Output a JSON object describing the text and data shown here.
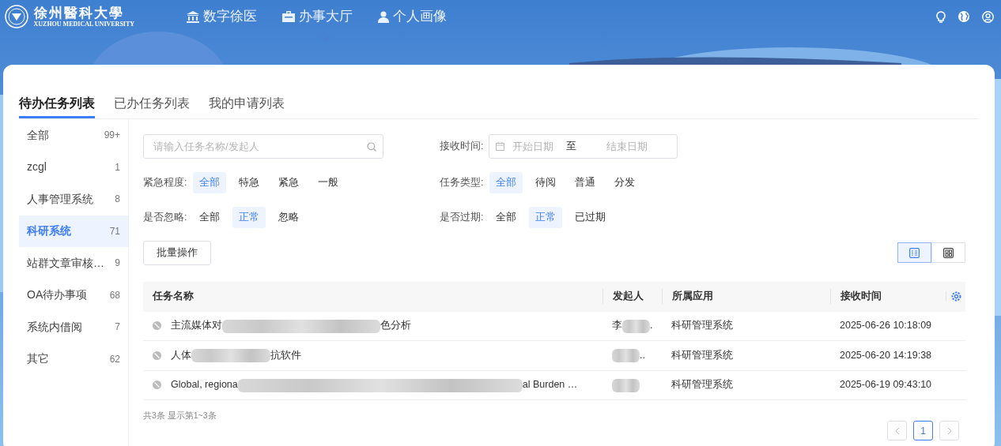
{
  "header": {
    "logo_title": "徐州醫科大學",
    "logo_subtitle": "XUZHOU MEDICAL UNIVERSITY",
    "nav": [
      {
        "label": "数字徐医"
      },
      {
        "label": "办事大厅"
      },
      {
        "label": "个人画像"
      }
    ]
  },
  "tabs": [
    {
      "label": "待办任务列表",
      "selected": true
    },
    {
      "label": "已办任务列表",
      "selected": false
    },
    {
      "label": "我的申请列表",
      "selected": false
    }
  ],
  "sidebar": {
    "items": [
      {
        "label": "全部",
        "count": "99+",
        "selected": false
      },
      {
        "label": "zcgl",
        "count": "1",
        "selected": false
      },
      {
        "label": "人事管理系统",
        "count": "8",
        "selected": false
      },
      {
        "label": "科研系统",
        "count": "71",
        "selected": true
      },
      {
        "label": "站群文章审核…",
        "count": "9",
        "selected": false
      },
      {
        "label": "OA待办事项",
        "count": "68",
        "selected": false
      },
      {
        "label": "系统内借阅",
        "count": "7",
        "selected": false
      },
      {
        "label": "其它",
        "count": "62",
        "selected": false
      }
    ]
  },
  "search": {
    "placeholder": "请输入任务名称/发起人"
  },
  "date_range": {
    "label": "接收时间:",
    "start_placeholder": "开始日期",
    "separator": "至",
    "end_placeholder": "结束日期"
  },
  "filters": [
    {
      "label": "紧急程度:",
      "options": [
        {
          "label": "全部",
          "selected": true
        },
        {
          "label": "特急",
          "selected": false
        },
        {
          "label": "紧急",
          "selected": false
        },
        {
          "label": "一般",
          "selected": false
        }
      ]
    },
    {
      "label": "任务类型:",
      "options": [
        {
          "label": "全部",
          "selected": true
        },
        {
          "label": "待阅",
          "selected": false
        },
        {
          "label": "普通",
          "selected": false
        },
        {
          "label": "分发",
          "selected": false
        }
      ]
    },
    {
      "label": "是否忽略:",
      "options": [
        {
          "label": "全部",
          "selected": false
        },
        {
          "label": "正常",
          "selected": true
        },
        {
          "label": "忽略",
          "selected": false
        }
      ]
    },
    {
      "label": "是否过期:",
      "options": [
        {
          "label": "全部",
          "selected": false
        },
        {
          "label": "正常",
          "selected": true
        },
        {
          "label": "已过期",
          "selected": false
        }
      ]
    }
  ],
  "batch_button": "批量操作",
  "view_toggle": [
    {
      "kind": "list",
      "selected": true
    },
    {
      "kind": "grid",
      "selected": false
    }
  ],
  "table": {
    "columns": [
      "任务名称",
      "发起人",
      "所属应用",
      "接收时间"
    ],
    "rows": [
      {
        "name_before": "主流媒体对",
        "name_after": "色分析",
        "initiator_before": "李",
        "initiator_after": ".",
        "app": "科研管理系统",
        "time": "2025-06-26 10:18:09"
      },
      {
        "name_before": "人体",
        "name_after": "抗软件",
        "initiator_after": "..",
        "app": "科研管理系统",
        "time": "2025-06-20 14:19:38"
      },
      {
        "name_before": "Global, regiona",
        "name_after": "al Burden …",
        "app": "科研管理系统",
        "time": "2025-06-19 09:43:10"
      }
    ]
  },
  "summary": "共3条 显示第1~3条",
  "pagination": {
    "pages": [
      {
        "label": "1",
        "selected": true
      }
    ]
  }
}
